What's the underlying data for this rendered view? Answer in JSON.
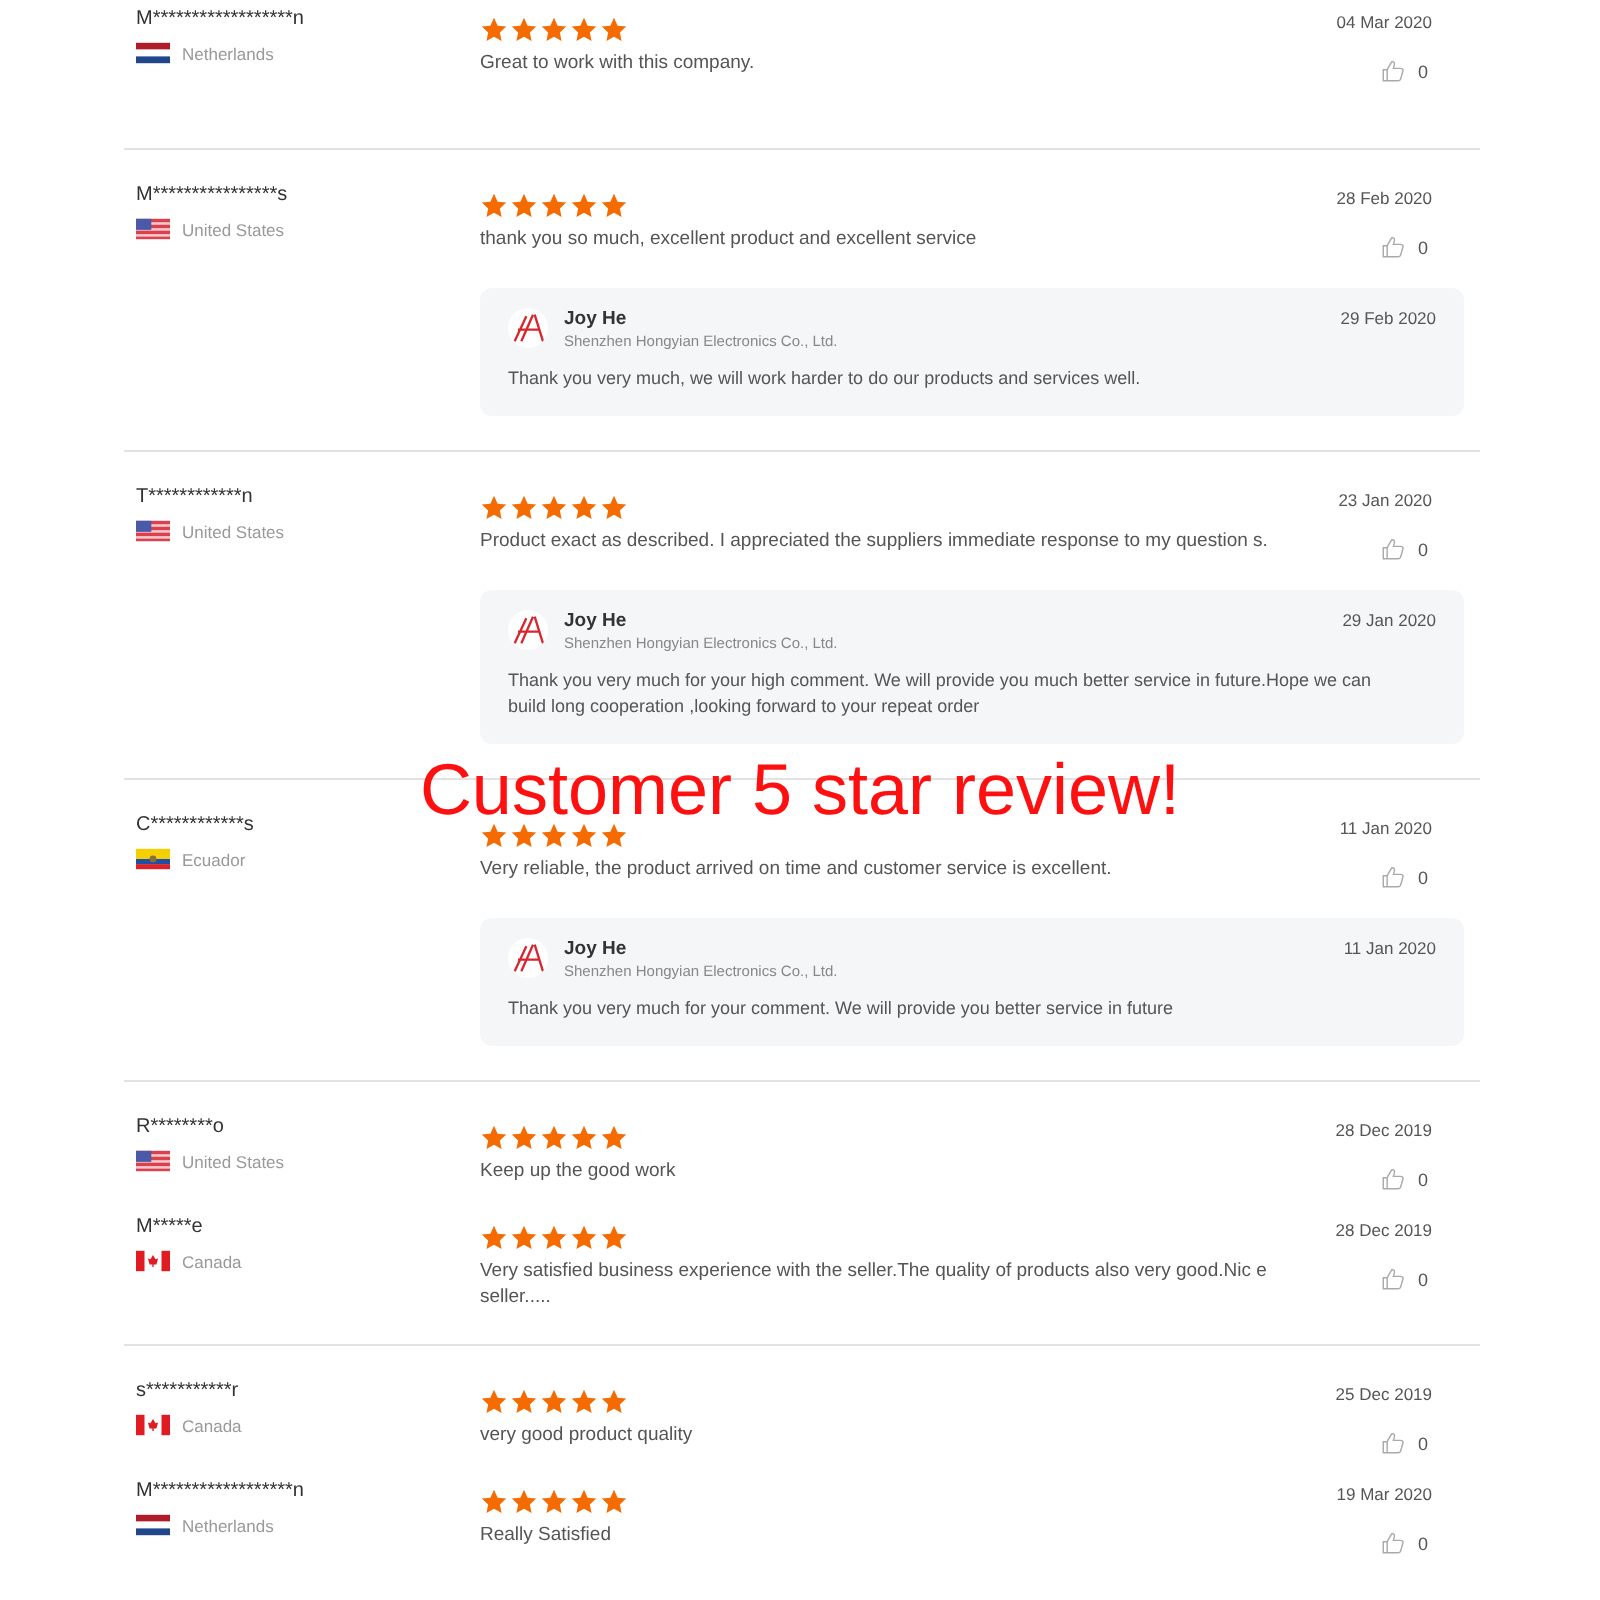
{
  "groups": [
    {
      "reviews": [
        {
          "name": "M******************n",
          "kind": "nl",
          "country": "Netherlands",
          "stars": 5,
          "text": "Great to work with this company.",
          "date": "04 Mar 2020",
          "likes": "0"
        }
      ]
    },
    {
      "reviews": [
        {
          "name": "M****************s",
          "kind": "us",
          "country": "United States",
          "stars": 5,
          "text": "thank you so much, excellent product and excellent service",
          "date": "28 Feb 2020",
          "likes": "0",
          "reply": {
            "author": "Joy He",
            "company": "Shenzhen Hongyian Electronics Co., Ltd.",
            "date": "29 Feb 2020",
            "text": "Thank you very much, we will work harder to do our products and services well."
          }
        }
      ]
    },
    {
      "reviews": [
        {
          "name": "T************n",
          "kind": "us",
          "country": "United States",
          "stars": 5,
          "text": "Product exact as described. I appreciated the suppliers immediate response to my question s.",
          "date": "23 Jan 2020",
          "likes": "0",
          "reply": {
            "author": "Joy He",
            "company": "Shenzhen Hongyian Electronics Co., Ltd.",
            "date": "29 Jan 2020",
            "text": "Thank you very much for your high comment. We will provide you much better service in future.Hope we can build long cooperation ,looking forward to your repeat order"
          }
        }
      ]
    },
    {
      "reviews": [
        {
          "name": "C************s",
          "kind": "ec",
          "country": "Ecuador",
          "stars": 5,
          "text": "Very reliable, the product arrived on time and customer service is excellent.",
          "date": "11 Jan 2020",
          "likes": "0",
          "reply": {
            "author": "Joy He",
            "company": "Shenzhen Hongyian Electronics Co., Ltd.",
            "date": "11 Jan 2020",
            "text": "Thank you very much for your comment. We will provide you better service in future"
          }
        }
      ]
    },
    {
      "reviews": [
        {
          "name": "R********o",
          "kind": "us",
          "country": "United States",
          "stars": 5,
          "text": "Keep up the good work",
          "date": "28 Dec 2019",
          "likes": "0"
        },
        {
          "name": "M*****e",
          "kind": "ca",
          "country": "Canada",
          "stars": 5,
          "text": "Very satisfied business experience with the seller.The quality of products also very good.Nic e seller.....",
          "date": "28 Dec 2019",
          "likes": "0"
        }
      ]
    },
    {
      "reviews": [
        {
          "name": "s***********r",
          "kind": "ca",
          "country": "Canada",
          "stars": 5,
          "text": "very good  product quality",
          "date": "25 Dec 2019",
          "likes": "0"
        },
        {
          "name": "M******************n",
          "kind": "nl",
          "country": "Netherlands",
          "stars": 5,
          "text": "Really Satisfied",
          "date": "19 Mar 2020",
          "likes": "0"
        }
      ]
    }
  ],
  "overlay": "Customer 5 star review!"
}
